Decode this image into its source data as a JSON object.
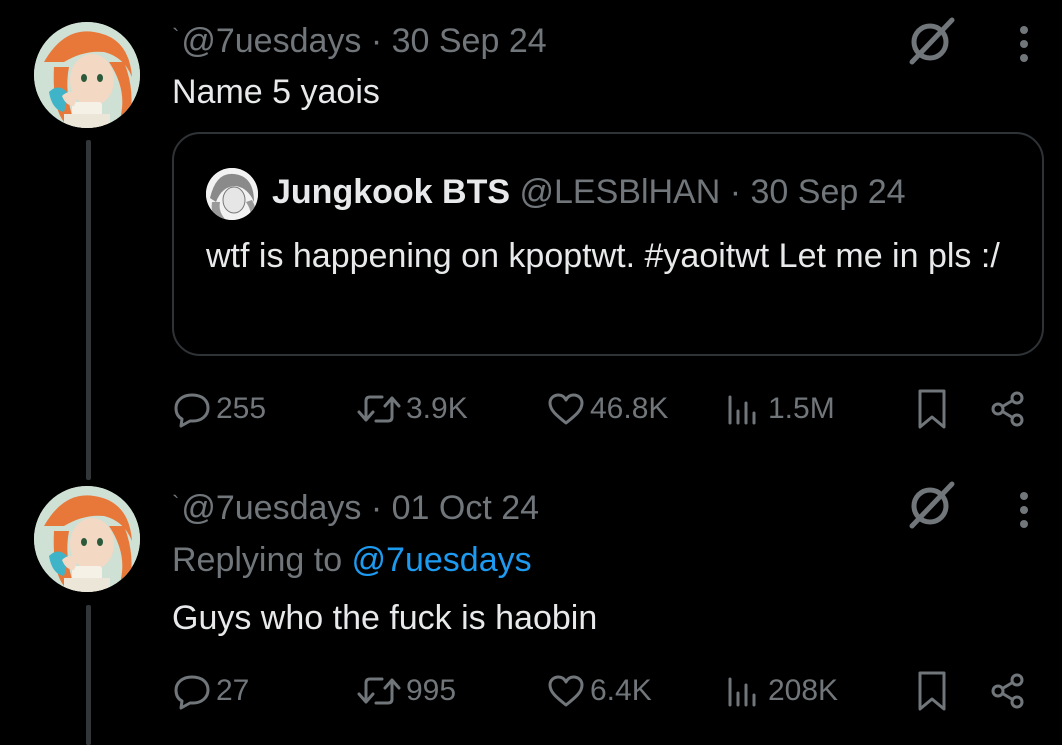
{
  "colors": {
    "background": "#000000",
    "text": "#e7e9ea",
    "muted": "#71767b",
    "accent": "#1d9bf0",
    "border": "#2f3336"
  },
  "tweets": [
    {
      "handle_prefix": "`",
      "handle": "@7uesdays",
      "separator": " · ",
      "date": "30 Sep 24",
      "text": "Name 5 yaois",
      "quote": {
        "name": "Jungkook BTS",
        "handle": "@LESBlHAN",
        "separator": " · ",
        "date": "30 Sep 24",
        "text": "wtf is happening on kpoptwt. #yaoitwt Let me in pls :/"
      },
      "stats": {
        "replies": "255",
        "reposts": "3.9K",
        "likes": "46.8K",
        "views": "1.5M"
      }
    },
    {
      "handle_prefix": "`",
      "handle": "@7uesdays",
      "separator": " · ",
      "date": "01 Oct 24",
      "replying_label": "Replying to ",
      "replying_to": "@7uesdays",
      "text": "Guys who the fuck is haobin",
      "stats": {
        "replies": "27",
        "reposts": "995",
        "likes": "6.4K",
        "views": "208K"
      }
    }
  ],
  "icons": {
    "reply": "reply-icon",
    "repost": "repost-icon",
    "like": "heart-icon",
    "views": "views-icon",
    "bookmark": "bookmark-icon",
    "share": "share-icon",
    "grok": "slashed-circle-icon",
    "more": "more-vertical-icon"
  }
}
